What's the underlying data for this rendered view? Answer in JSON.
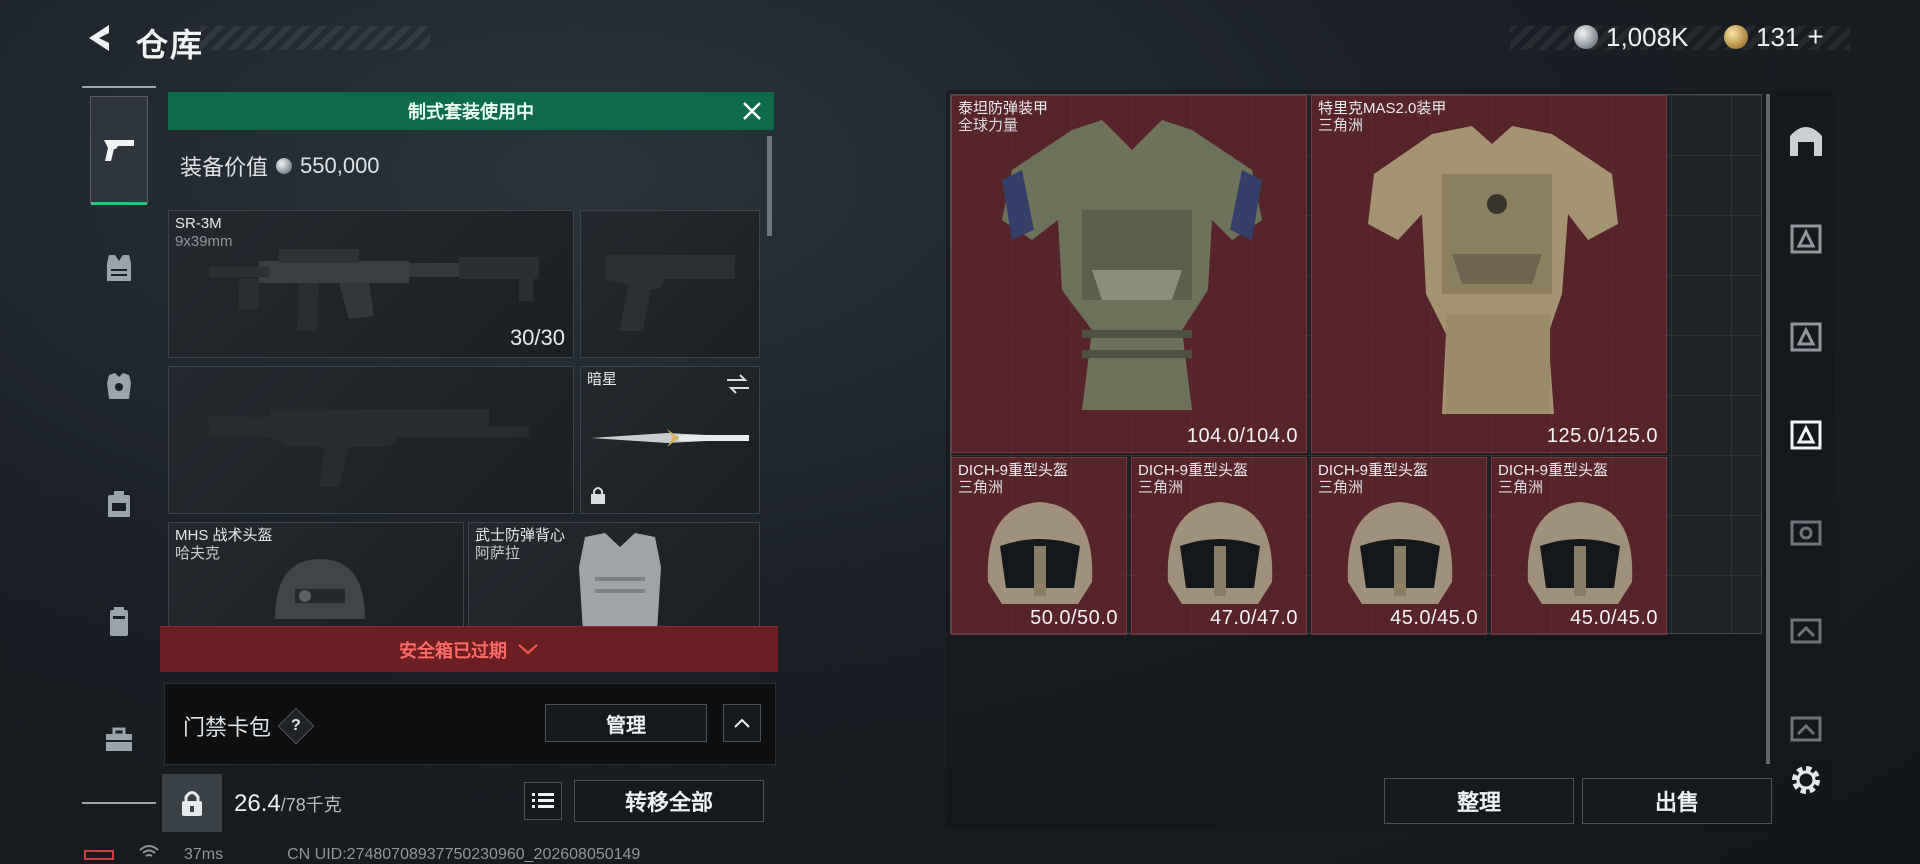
{
  "header": {
    "title": "仓库",
    "currency": [
      {
        "icon": "silver-coin-icon",
        "value": "1,008K"
      },
      {
        "icon": "gold-coin-icon",
        "value": "131",
        "plus": "+"
      }
    ]
  },
  "left_nav": {
    "items": [
      {
        "name": "pistol-icon",
        "active": true
      },
      {
        "name": "vest-icon"
      },
      {
        "name": "armor-icon"
      },
      {
        "name": "backpack-icon"
      },
      {
        "name": "pouch-icon"
      },
      {
        "name": "toolbox-icon"
      }
    ]
  },
  "loadout": {
    "banner": "制式套装使用中",
    "equip_value_label": "装备价值",
    "equip_value": "550,000",
    "primary": {
      "name": "SR-3M",
      "ammo": "9x39mm",
      "count": "30/30"
    },
    "melee": {
      "name": "暗星"
    },
    "helmet": {
      "name": "MHS 战术头盔",
      "sub": "哈夫克"
    },
    "armor": {
      "name": "武士防弹背心",
      "sub": "阿萨拉"
    },
    "warning": "安全箱已过期",
    "keycard_label": "门禁卡包",
    "keycard_help": "?",
    "manage_btn": "管理",
    "weight": "26.4",
    "weight_max": "/78千克",
    "transfer_all_btn": "转移全部"
  },
  "storage": {
    "items": [
      {
        "name": "泰坦防弹装甲",
        "sub": "全球力量",
        "dur": "104.0/104.0"
      },
      {
        "name": "特里克MAS2.0装甲",
        "sub": "三角洲",
        "dur": "125.0/125.0"
      },
      {
        "name": "DICH-9重型头盔",
        "sub": "三角洲",
        "dur": "50.0/50.0"
      },
      {
        "name": "DICH-9重型头盔",
        "sub": "三角洲",
        "dur": "47.0/47.0"
      },
      {
        "name": "DICH-9重型头盔",
        "sub": "三角洲",
        "dur": "45.0/45.0"
      },
      {
        "name": "DICH-9重型头盔",
        "sub": "三角洲",
        "dur": "45.0/45.0"
      }
    ],
    "sort_btn": "整理",
    "sell_btn": "出售"
  },
  "right_nav": {
    "items": [
      "vault-icon",
      "tier3-armor-filter-icon",
      "tier3-armor-filter-icon",
      "tier3-armor-filter-icon-active",
      "tier4-filter-icon",
      "tier3-filter-icon",
      "tier3-filter-icon"
    ],
    "settings": "gear-icon"
  },
  "footer": {
    "ping": "37ms",
    "uid": "CN UID:27480708937750230960_202608050149"
  }
}
